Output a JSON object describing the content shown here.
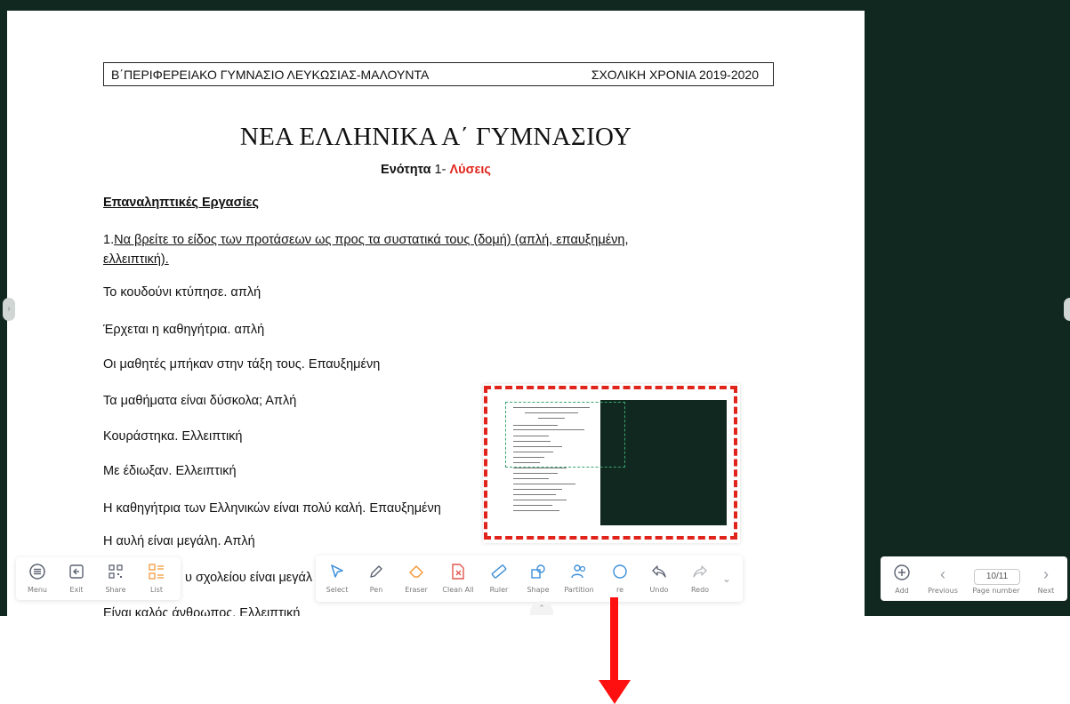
{
  "document": {
    "header_left": "Β΄ΠΕΡΙΦΕΡΕΙΑΚΟ ΓΥΜΝΑΣΙΟ ΛΕΥΚΩΣΙΑΣ-ΜΑΛΟΥΝΤΑ",
    "header_right": "ΣΧΟΛΙΚΗ ΧΡΟΝΙΑ 2019-2020",
    "title": "ΝΕΑ ΕΛΛΗΝΙΚΑ Α΄ ΓΥΜΝΑΣΙΟΥ",
    "subtitle_prefix": "Ενότητα",
    "subtitle_num": " 1- ",
    "subtitle_answers": "Λύσεις",
    "section_heading": "Επαναληπτικές Εργασίες",
    "question_number": "1.",
    "question_line1": "Να βρείτε το είδος των προτάσεων ως προς τα συστατικά τους (δομή) (απλή, επαυξημένη,",
    "question_line2": "ελλειπτική).",
    "answers": [
      "Το κουδούνι κτύπησε. απλή",
      "Έρχεται η καθηγήτρια. απλή",
      "Οι μαθητές μπήκαν στην τάξη τους. Επαυξημένη",
      "Τα μαθήματα είναι δύσκολα; Απλή",
      "Κουράστηκα. Ελλειπτική",
      "Με έδιωξαν. Ελλειπτική",
      "Η καθηγήτρια των Ελληνικών είναι πολύ καλή. Επαυξημένη",
      "Η αυλή είναι μεγάλη. Απλή",
      "υ σχολείου είναι μεγάλ",
      "Είναι καλός άνθρωπος. Ελλειπτική"
    ]
  },
  "left_toolbar": [
    {
      "label": "Menu",
      "icon": "menu-icon"
    },
    {
      "label": "Exit",
      "icon": "exit-icon"
    },
    {
      "label": "Share",
      "icon": "qr-share-icon"
    },
    {
      "label": "List",
      "icon": "list-icon"
    }
  ],
  "main_toolbar": [
    {
      "label": "Select",
      "icon": "cursor-icon"
    },
    {
      "label": "Pen",
      "icon": "pen-icon"
    },
    {
      "label": "Eraser",
      "icon": "eraser-icon"
    },
    {
      "label": "Clean All",
      "icon": "clean-all-icon"
    },
    {
      "label": "Ruler",
      "icon": "ruler-icon"
    },
    {
      "label": "Shape",
      "icon": "shape-icon"
    },
    {
      "label": "Partition",
      "icon": "partition-icon"
    },
    {
      "label": "re",
      "icon": "more-icon"
    },
    {
      "label": "Undo",
      "icon": "undo-icon"
    },
    {
      "label": "Redo",
      "icon": "redo-icon"
    }
  ],
  "page_nav": {
    "add_label": "Add",
    "previous_label": "Previous",
    "page_value": "10/11",
    "page_label": "Page number",
    "next_label": "Next"
  },
  "colors": {
    "board": "#112820",
    "annotation_red": "#e0241b",
    "tool_blue": "#3c8fd8",
    "tool_orange": "#f29a3c"
  }
}
